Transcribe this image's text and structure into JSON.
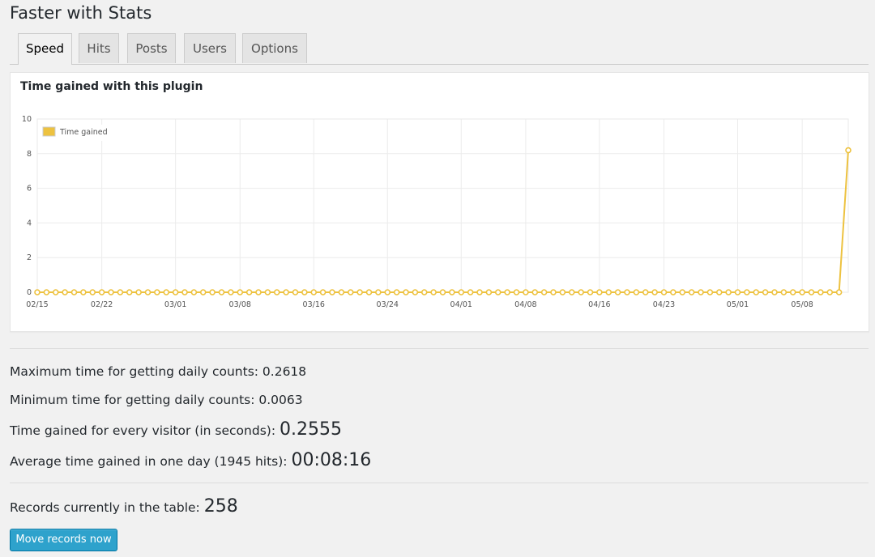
{
  "page": {
    "title": "Faster with Stats"
  },
  "tabs": [
    {
      "label": "Speed",
      "active": true
    },
    {
      "label": "Hits",
      "active": false
    },
    {
      "label": "Posts",
      "active": false
    },
    {
      "label": "Users",
      "active": false
    },
    {
      "label": "Options",
      "active": false
    }
  ],
  "chart": {
    "title": "Time gained with this plugin"
  },
  "chart_data": {
    "type": "line",
    "x_start": "02/15",
    "x_count": 89,
    "x_tick_labels": [
      "02/15",
      "02/22",
      "03/01",
      "03/08",
      "03/16",
      "03/24",
      "04/01",
      "04/08",
      "04/16",
      "04/23",
      "05/01",
      "05/08"
    ],
    "y_tick_labels": [
      "0",
      "2",
      "4",
      "6",
      "8",
      "10"
    ],
    "ylim": [
      0,
      10
    ],
    "grid": true,
    "legend_position": "top-left",
    "series": [
      {
        "name": "Time gained",
        "color": "#edc240",
        "nonzero_points": [
          {
            "index": 88,
            "value": 8.2
          }
        ],
        "default_value": 0
      }
    ]
  },
  "stats": {
    "max_label": "Maximum time for getting daily counts: ",
    "max_value": "0.2618",
    "min_label": "Minimum time for getting daily counts: ",
    "min_value": "0.0063",
    "visitor_label": "Time gained for every visitor (in seconds): ",
    "visitor_value": "0.2555",
    "avg_label": "Average time gained in one day (1945 hits): ",
    "avg_value": "00:08:16",
    "records_label": "Records currently in the table: ",
    "records_value": "258"
  },
  "actions": {
    "move_records_label": "Move records now"
  }
}
